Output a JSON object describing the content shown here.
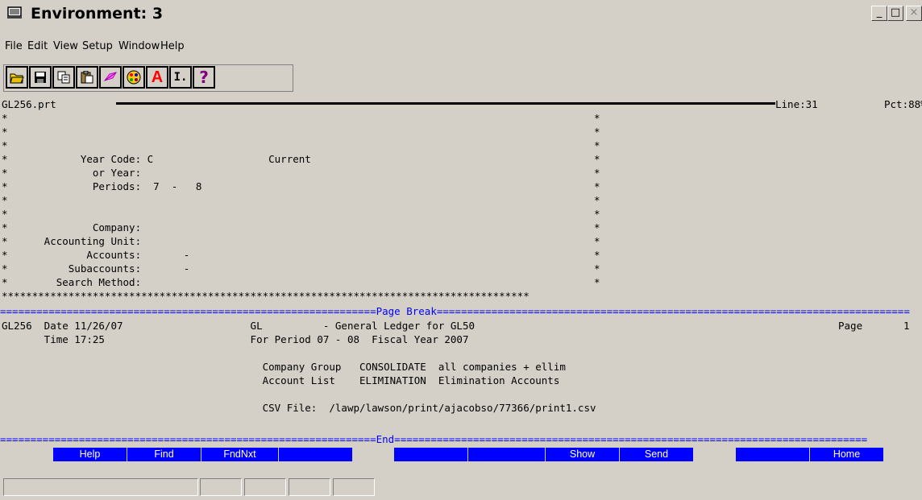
{
  "window": {
    "title": "Environment: 3",
    "minimize_glyph": "_",
    "maximize_glyph": "□",
    "close_glyph": "×"
  },
  "menu": [
    "File",
    "Edit",
    "View",
    "Setup",
    "Window",
    "Help"
  ],
  "toolbar": [
    "open-icon",
    "save-icon",
    "copy-icon",
    "paste-icon",
    "print-icon",
    "color-icon",
    "font-icon",
    "cursor-icon",
    "help-icon"
  ],
  "toolbar_glyphs": {
    "font": "A",
    "cursor": "I.",
    "help": "?"
  },
  "status": {
    "file": "GL256.prt",
    "line": "Line:31",
    "pct": "Pct:88%"
  },
  "report_params": [
    {
      "label": "*",
      "value": "",
      "mark": "*"
    },
    {
      "label": "*",
      "value": "",
      "mark": "*"
    },
    {
      "label": "*",
      "value": "",
      "mark": "*"
    },
    {
      "label": "*            Year Code: C                   Current",
      "mark": "*"
    },
    {
      "label": "*              or Year:",
      "mark": "*"
    },
    {
      "label": "*              Periods:  7  -   8",
      "mark": "*"
    },
    {
      "label": "*",
      "mark": "*"
    },
    {
      "label": "*",
      "mark": "*"
    },
    {
      "label": "*              Company:",
      "mark": "*"
    },
    {
      "label": "*      Accounting Unit:",
      "mark": "*"
    },
    {
      "label": "*             Accounts:       -",
      "mark": "*"
    },
    {
      "label": "*          Subaccounts:       -",
      "mark": "*"
    },
    {
      "label": "*        Search Method:",
      "mark": "*"
    }
  ],
  "stars_line": "***************************************************************************************",
  "page_break": {
    "left": "==============================================================",
    "label": "Page Break",
    "right": "=============================================================================="
  },
  "report": {
    "l1": "GL256  Date 11/26/07                     GL          - General Ledger for GL50",
    "page_label": "Page",
    "page_num": "1",
    "l2": "       Time 17:25                        For Period 07 - 08  Fiscal Year 2007",
    "l3": "                                           Company Group   CONSOLIDATE  all companies + ellim",
    "l4": "                                           Account List    ELIMINATION  Elimination Accounts",
    "l5": "                                           CSV File:  /lawp/lawson/print/ajacobso/77366/print1.csv"
  },
  "end_line": {
    "left": "==============================================================",
    "label": "End",
    "right": "=============================================================================="
  },
  "fkeys": [
    "Help",
    "Find",
    "FndNxt",
    "",
    "",
    "",
    "Show",
    "Send",
    "",
    "Home"
  ]
}
